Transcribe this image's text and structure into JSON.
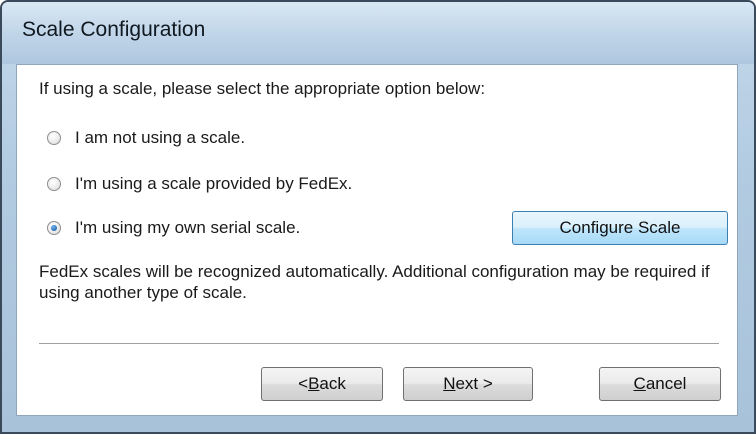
{
  "window": {
    "title": "Scale Configuration"
  },
  "dialog": {
    "instruction": "If using a scale, please select the appropriate option below:",
    "options": [
      {
        "label": "I am not using a scale.",
        "checked": false
      },
      {
        "label": "I'm using a scale provided by FedEx.",
        "checked": false
      },
      {
        "label": "I'm using my own serial scale.",
        "checked": true
      }
    ],
    "configure_button": "Configure Scale",
    "note": "FedEx scales will be recognized automatically. Additional configuration may be required if using another type of scale."
  },
  "footer": {
    "back": {
      "prefix": "<",
      "mnemonic": "B",
      "rest": "ack"
    },
    "next": {
      "mnemonic": "N",
      "rest": "ext >"
    },
    "cancel": {
      "mnemonic": "C",
      "rest": "ancel"
    }
  }
}
